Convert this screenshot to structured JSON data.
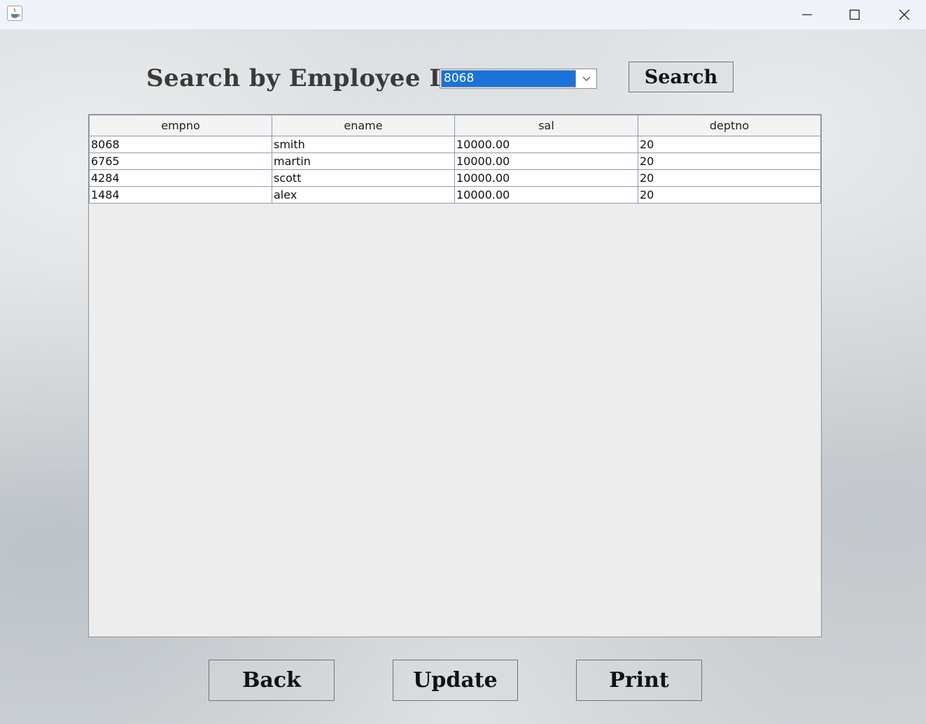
{
  "titlebar": {
    "icons": [
      "java-icon",
      "minimize-icon",
      "maximize-icon",
      "close-icon"
    ]
  },
  "search": {
    "label": "Search by Employee ID:",
    "selected_value": "8068",
    "button_label": "Search"
  },
  "table": {
    "columns": [
      "empno",
      "ename",
      "sal",
      "deptno"
    ],
    "rows": [
      [
        "8068",
        "smith",
        "10000.00",
        "20"
      ],
      [
        "6765",
        "martin",
        "10000.00",
        "20"
      ],
      [
        "4284",
        "scott",
        "10000.00",
        "20"
      ],
      [
        "1484",
        "alex",
        "10000.00",
        "20"
      ]
    ]
  },
  "footer": {
    "back_label": "Back",
    "update_label": "Update",
    "print_label": "Print"
  },
  "colors": {
    "selection": "#1a73d9",
    "grid": "#8c9ab0",
    "table_bg": "#ededed"
  }
}
